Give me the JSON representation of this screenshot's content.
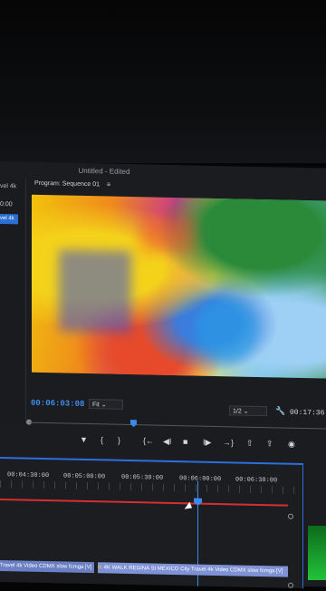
{
  "window": {
    "title": "Untitled - Edited"
  },
  "project_panel": {
    "label": "vel 4k",
    "timecode": "0:00",
    "selected_item": "vel 4k"
  },
  "program_monitor": {
    "header": "Program: Sequence 01",
    "menu_icon": "hamburger-icon",
    "current_timecode": "00:06:03:08",
    "fit_label": "Fit",
    "resolution_label": "1/2",
    "duration_timecode": "00:17:36",
    "scrub_progress": 0.25
  },
  "transport": {
    "buttons": [
      {
        "name": "add-marker-icon",
        "glyph": "▼"
      },
      {
        "name": "mark-in-icon",
        "glyph": "{"
      },
      {
        "name": "mark-out-icon",
        "glyph": "}"
      },
      {
        "name": "go-to-in-icon",
        "glyph": "{←"
      },
      {
        "name": "step-back-icon",
        "glyph": "◀I"
      },
      {
        "name": "stop-icon",
        "glyph": "■"
      },
      {
        "name": "step-forward-icon",
        "glyph": "I▶"
      },
      {
        "name": "go-to-out-icon",
        "glyph": "→}"
      },
      {
        "name": "lift-icon",
        "glyph": "⇧"
      },
      {
        "name": "extract-icon",
        "glyph": "⇪"
      },
      {
        "name": "export-frame-icon",
        "glyph": "◉"
      }
    ]
  },
  "timeline": {
    "ruler": [
      "00:04:30:00",
      "00:05:00:00",
      "00:05:30:00",
      "00:06:00:00",
      "00:06:30:00"
    ],
    "clips": [
      {
        "label": "Travel 4k Video CDMX slow fcmga [V]"
      },
      {
        "label": "4K WALK REGINA St MEXICO City Travel 4k Video CDMX slow fcmga [V]"
      }
    ]
  }
}
